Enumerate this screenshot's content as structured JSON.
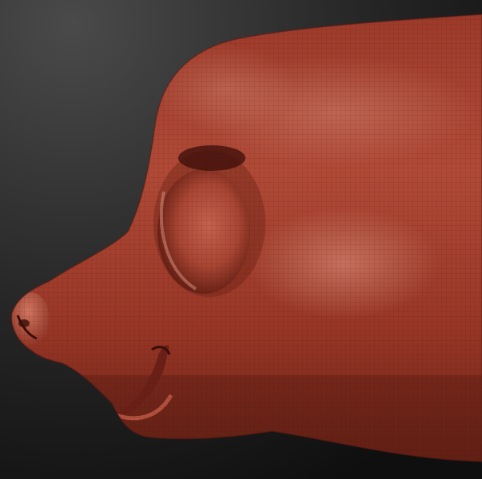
{
  "scene": {
    "subject": "sculpt-head-profile",
    "colors": {
      "background_top": "#4a4a4a",
      "background_bottom": "#0f0f0f",
      "clay_base": "#a8412f",
      "clay_highlight": "#d97764",
      "clay_shadow": "#5a1a12",
      "wire": "#3d120c"
    }
  }
}
